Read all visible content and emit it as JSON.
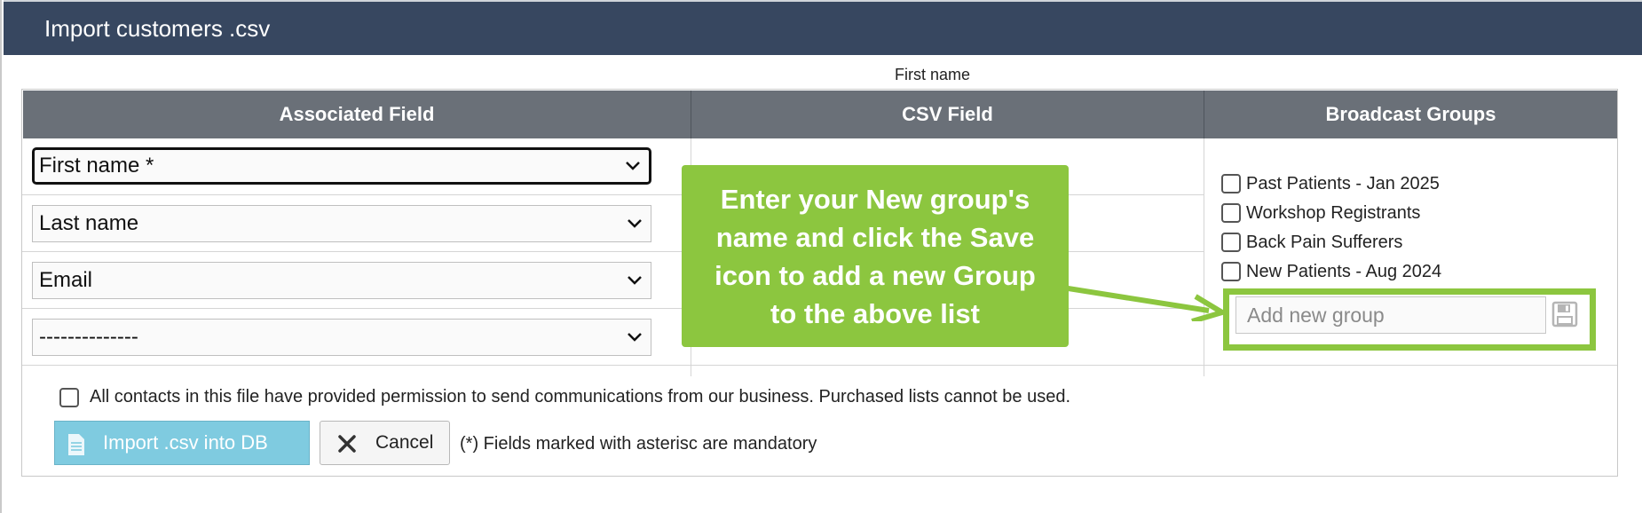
{
  "window": {
    "title": "Import customers .csv"
  },
  "table": {
    "headers": [
      "Associated Field",
      "CSV Field",
      "Broadcast Groups"
    ],
    "rows": [
      {
        "associated_field": "First name *",
        "csv_field": "First name"
      },
      {
        "associated_field": "Last name",
        "csv_field": ""
      },
      {
        "associated_field": "Email",
        "csv_field": ""
      },
      {
        "associated_field": "--------------",
        "csv_field": ""
      }
    ]
  },
  "groups": {
    "items": [
      {
        "label": "Past Patients - Jan 2025",
        "checked": false
      },
      {
        "label": "Workshop Registrants",
        "checked": false
      },
      {
        "label": "Back Pain Sufferers",
        "checked": false
      },
      {
        "label": "New Patients - Aug 2024",
        "checked": false
      }
    ],
    "add_placeholder": "Add new group",
    "save_icon": "floppy-disk-icon"
  },
  "callout": {
    "text": "Enter your New group's name and click the Save icon to add a new Group to the above list",
    "color": "#8cc63f"
  },
  "consent": {
    "label": "All contacts in this file have provided permission to send communications from our business. Purchased lists cannot be used.",
    "checked": false
  },
  "actions": {
    "import_label": "Import .csv into DB",
    "cancel_label": "Cancel",
    "note": "(*) Fields marked with asterisc are mandatory"
  },
  "colors": {
    "title_bar": "#374760",
    "header": "#6a7078",
    "import_button": "#7fcbe0",
    "highlight": "#8cc63f"
  }
}
